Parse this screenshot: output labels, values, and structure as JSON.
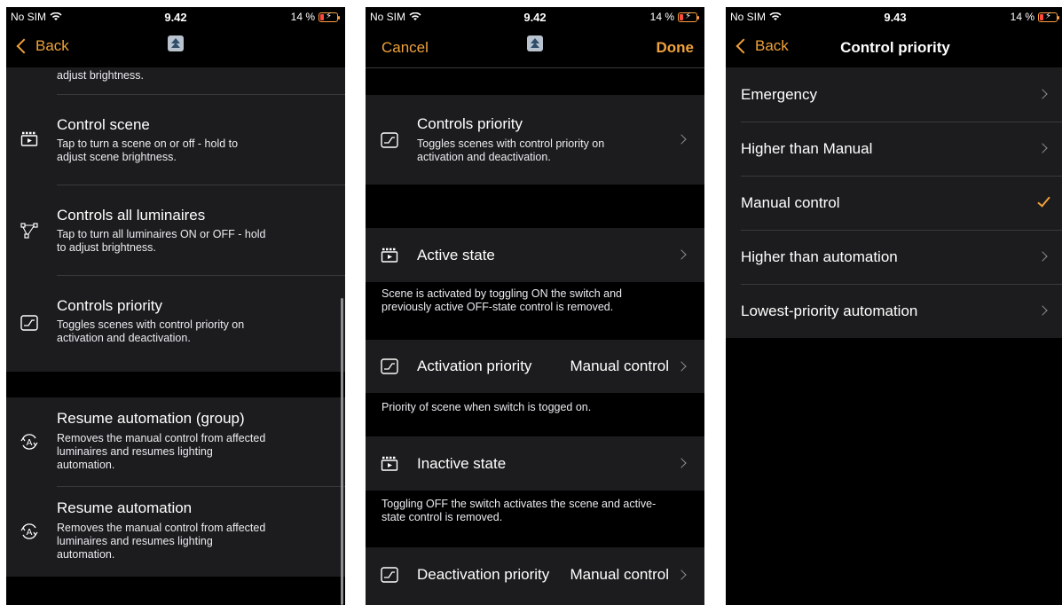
{
  "status": {
    "carrier": "No SIM",
    "battery": "14 %",
    "time1": "9.42",
    "time2": "9.42",
    "time3": "9.43"
  },
  "s1": {
    "back": "Back",
    "top_cut": "adjust brightness.",
    "items": [
      {
        "title": "Control scene",
        "desc1": "Tap to turn a scene on or off - hold to",
        "desc2": "adjust scene brightness.",
        "desc3": ""
      },
      {
        "title": "Controls all luminaires",
        "desc1": "Tap to turn all luminaires ON or OFF - hold",
        "desc2": "to adjust brightness.",
        "desc3": ""
      },
      {
        "title": "Controls priority",
        "desc1": "Toggles scenes with control priority on",
        "desc2": "activation and deactivation.",
        "desc3": ""
      },
      {
        "title": "Resume automation (group)",
        "desc1": "Removes the manual control from affected",
        "desc2": "luminaires and resumes lighting",
        "desc3": "automation."
      },
      {
        "title": "Resume automation",
        "desc1": "Removes the manual control from affected",
        "desc2": "luminaires and resumes lighting",
        "desc3": "automation."
      }
    ]
  },
  "s2": {
    "cancel": "Cancel",
    "done": "Done",
    "header_title": "Controls priority",
    "header_desc1": "Toggles scenes with control priority on",
    "header_desc2": "activation and deactivation.",
    "active_state": "Active state",
    "active_note1": "Scene is activated by toggling ON the switch and",
    "active_note2": "previously active OFF-state control is removed.",
    "activation_priority": "Activation priority",
    "activation_value": "Manual control",
    "activation_note": "Priority of scene when switch is togged on.",
    "inactive_state": "Inactive state",
    "inactive_note1": "Toggling OFF the switch activates the scene and active-",
    "inactive_note2": "state control is removed.",
    "deactivation_priority": "Deactivation priority",
    "deactivation_value": "Manual control"
  },
  "s3": {
    "back": "Back",
    "title": "Control priority",
    "options": [
      "Emergency",
      "Higher than Manual",
      "Manual control",
      "Higher than automation",
      "Lowest-priority automation"
    ],
    "selected": "Manual control"
  },
  "colors": {
    "accent": "#f0a23b",
    "cell": "#1c1c1e",
    "background": "#000000"
  },
  "icons": {
    "scene": "scene-clapper-icon",
    "luminaires": "luminaires-network-icon",
    "priority": "priority-curve-icon",
    "resume": "resume-automation-icon"
  }
}
